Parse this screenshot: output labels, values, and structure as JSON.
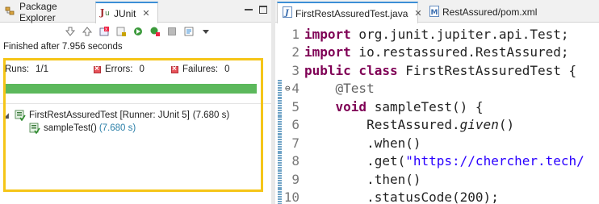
{
  "left_panel": {
    "tabs": [
      {
        "label": "Package Explorer",
        "icon": "package-explorer-icon"
      },
      {
        "label": "JUnit",
        "icon": "junit-icon",
        "active": true
      }
    ],
    "toolbar_icons": [
      "next-failure-icon",
      "previous-failure-icon",
      "show-failures-only-icon",
      "scroll-lock-icon",
      "rerun-icon",
      "rerun-failed-first-icon",
      "stop-icon",
      "test-history-icon",
      "view-menu-icon"
    ],
    "status_text": "Finished after 7.956 seconds",
    "counters": {
      "runs_label": "Runs:",
      "runs_value": "1/1",
      "errors_label": "Errors:",
      "errors_value": "0",
      "failures_label": "Failures:",
      "failures_value": "0"
    },
    "progress_fraction": 1.0,
    "progress_color": "#5cb85c",
    "tree": {
      "class_label": "FirstRestAssuredTest [Runner: JUnit 5]",
      "class_time": "(7.680 s)",
      "method_label": "sampleTest()",
      "method_time": "(7.680 s)"
    },
    "highlight_color": "#f5c518"
  },
  "editor": {
    "tabs": [
      {
        "label": "FirstRestAssuredTest.java",
        "icon": "java-file-icon",
        "active": true
      },
      {
        "label": "RestAssured/pom.xml",
        "icon": "maven-pom-icon"
      }
    ],
    "lines": [
      {
        "num": "1",
        "kw": "import",
        "text": " org.junit.jupiter.api.Test;"
      },
      {
        "num": "2",
        "kw": "import",
        "text": " io.restassured.RestAssured;"
      },
      {
        "num": "3",
        "kw": "public class",
        "text": " FirstRestAssuredTest {"
      },
      {
        "num": "4",
        "ann": "@Test"
      },
      {
        "num": "5",
        "kw": "void",
        "text": " sampleTest() {"
      },
      {
        "num": "6",
        "pre": "RestAssured.",
        "it": "given",
        "post": "()"
      },
      {
        "num": "7",
        "text": ".when()"
      },
      {
        "num": "8",
        "pre": ".get(",
        "str": "\"https://chercher.tech/"
      },
      {
        "num": "9",
        "text": ".then()"
      },
      {
        "num": "10",
        "text": ".statusCode(200);"
      }
    ]
  }
}
